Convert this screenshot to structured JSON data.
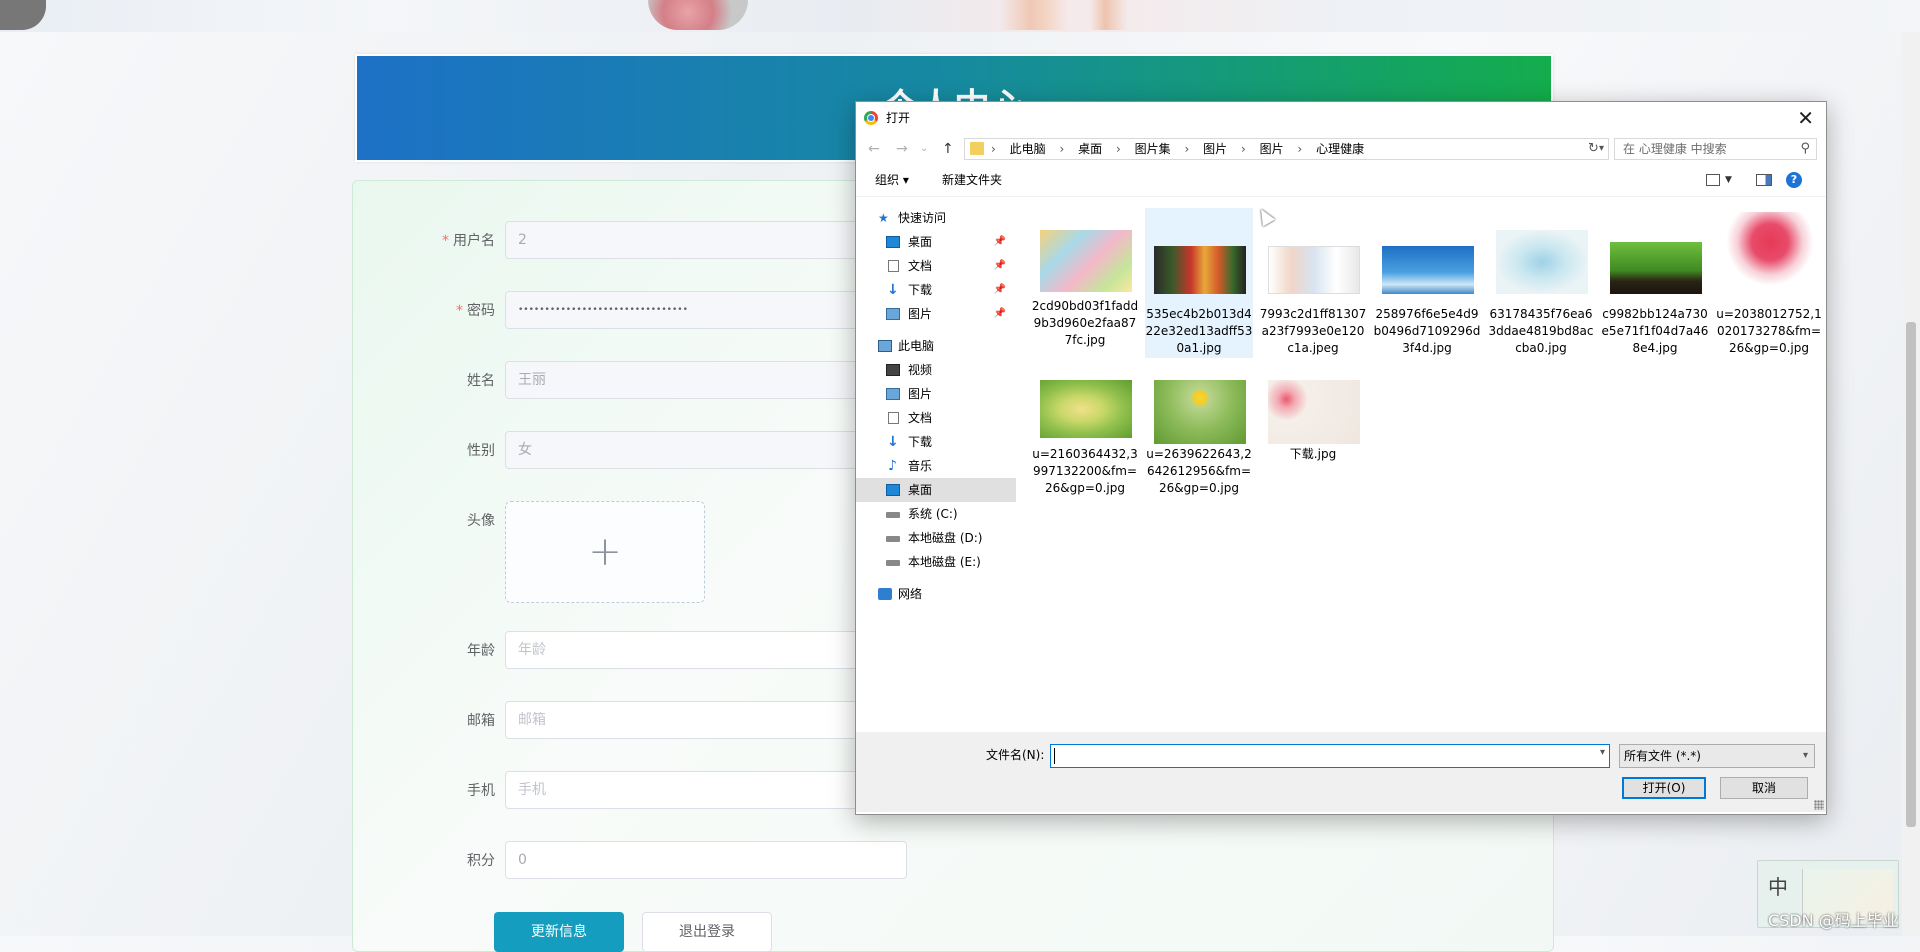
{
  "page": {
    "header_title": "个人中心",
    "form": {
      "username_label": "用户名",
      "username_value": "2",
      "password_label": "密码",
      "password_value": "••••••••••••••••••••••••••••••••",
      "name_label": "姓名",
      "name_value": "王丽",
      "gender_label": "性别",
      "gender_value": "女",
      "avatar_label": "头像",
      "age_label": "年龄",
      "age_placeholder": "年龄",
      "email_label": "邮箱",
      "email_placeholder": "邮箱",
      "phone_label": "手机",
      "phone_placeholder": "手机",
      "points_label": "积分",
      "points_value": "0",
      "required_mark": "*",
      "upload_plus": "+",
      "update_button": "更新信息",
      "logout_button": "退出登录"
    }
  },
  "dialog": {
    "title": "打开",
    "close_symbol": "✕",
    "nav": {
      "back": "←",
      "forward": "→",
      "recent": "⌄",
      "up": "↑"
    },
    "breadcrumb": [
      "此电脑",
      "桌面",
      "图片集",
      "图片",
      "图片",
      "心理健康"
    ],
    "breadcrumb_sep": "›",
    "search_placeholder": "在 心理健康 中搜索",
    "toolbar": {
      "organize": "组织 ▾",
      "new_folder": "新建文件夹",
      "help": "?"
    },
    "sidebar": {
      "quick_access": "快速访问",
      "quick_items": [
        "桌面",
        "文档",
        "下载",
        "图片"
      ],
      "this_pc": "此电脑",
      "pc_items": [
        "视频",
        "图片",
        "文档",
        "下载",
        "音乐",
        "桌面",
        "系统 (C:)",
        "本地磁盘 (D:)",
        "本地磁盘 (E:)"
      ],
      "network": "网络",
      "selected": "桌面"
    },
    "files": [
      {
        "name": "2cd90bd03f1fadd9b3d960e2faa877fc.jpg"
      },
      {
        "name": "535ec4b2b013d422e32ed13adff530a1.jpg"
      },
      {
        "name": "7993c2d1ff81307a23f7993e0e120c1a.jpeg"
      },
      {
        "name": "258976f6e5e4d9b0496d7109296d3f4d.jpg"
      },
      {
        "name": "63178435f76ea63ddae4819bd8accba0.jpg"
      },
      {
        "name": "c9982bb124a730e5e71f1f04d7a468e4.jpg"
      },
      {
        "name": "u=2038012752,1020173278&fm=26&gp=0.jpg"
      },
      {
        "name": "u=2160364432,3997132200&fm=26&gp=0.jpg"
      },
      {
        "name": "u=2639622643,2642612956&fm=26&gp=0.jpg"
      },
      {
        "name": "下载.jpg"
      }
    ],
    "filename_label": "文件名(N):",
    "filename_value": "",
    "filetype": "所有文件 (*.*)",
    "open_button": "打开(O)",
    "cancel_button": "取消"
  },
  "widget": {
    "ime": "中"
  },
  "watermark": "CSDN @码上毕业"
}
